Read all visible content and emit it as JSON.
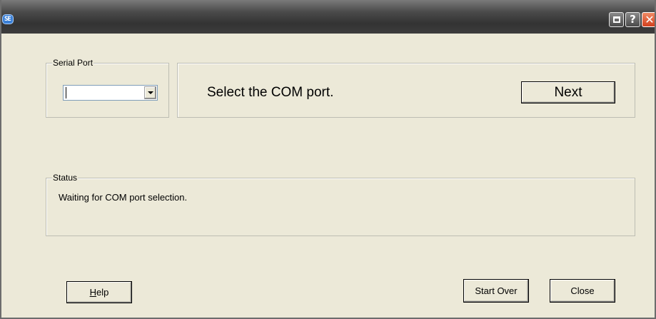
{
  "titlebar": {
    "icon": "app-logo-icon",
    "icon_text": "SE",
    "restore_icon": "restore-window-icon",
    "help_label": "?",
    "close_label": "✕"
  },
  "serial_port": {
    "legend": "Serial Port",
    "value": ""
  },
  "instruction": {
    "message": "Select the COM port.",
    "next_label": "Next"
  },
  "status": {
    "legend": "Status",
    "text": "Waiting for COM port selection."
  },
  "footer": {
    "help_mnemonic": "H",
    "help_rest": "elp",
    "start_over_label": "Start Over",
    "close_label": "Close"
  },
  "colors": {
    "titlebar": "#3d3d3d",
    "window_bg": "#ece9d8",
    "close_button": "#d2401e"
  }
}
